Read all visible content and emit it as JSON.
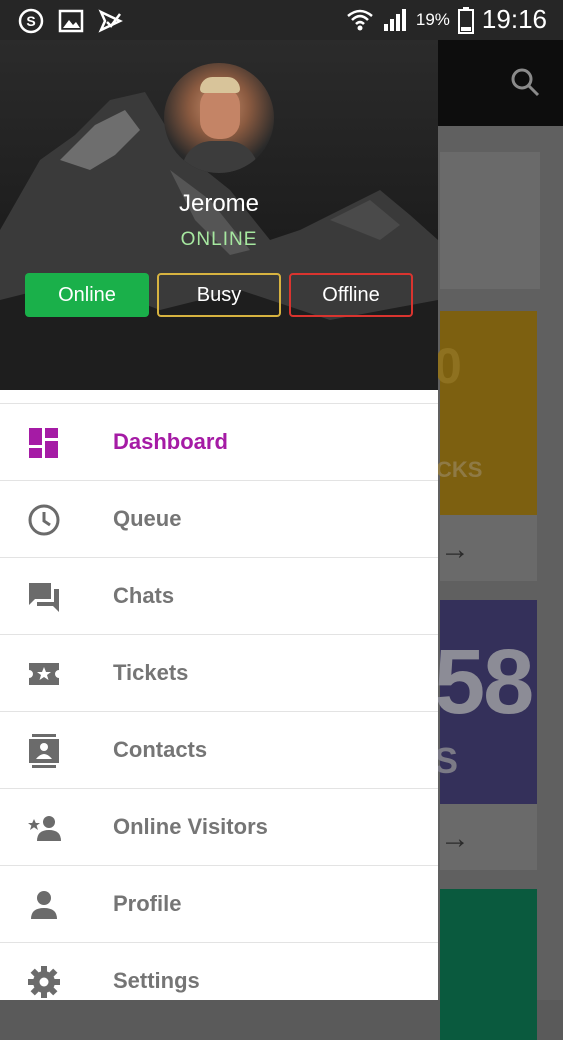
{
  "status_bar": {
    "battery_percent": "19%",
    "time": "19:16",
    "icons": [
      "skype-icon",
      "image-icon",
      "task-check-icon",
      "wifi-icon",
      "signal-icon",
      "battery-icon"
    ]
  },
  "background_app": {
    "cards": [
      {
        "color": "#7d6010",
        "text_fragment": "CKS",
        "digit_fragment": "0"
      },
      {
        "color": "#34305a",
        "number_fragment": "58",
        "text_fragment": "S"
      },
      {
        "color": "#0a5a3e"
      }
    ]
  },
  "drawer": {
    "user": {
      "name": "Jerome",
      "status": "ONLINE"
    },
    "status_buttons": [
      {
        "label": "Online",
        "color": "#1ab04a"
      },
      {
        "label": "Busy",
        "color": "#d7b340"
      },
      {
        "label": "Offline",
        "color": "#d9342f"
      }
    ],
    "menu": [
      {
        "label": "Dashboard",
        "icon": "dashboard-icon",
        "active": true
      },
      {
        "label": "Queue",
        "icon": "clock-icon"
      },
      {
        "label": "Chats",
        "icon": "chat-icon"
      },
      {
        "label": "Tickets",
        "icon": "ticket-icon"
      },
      {
        "label": "Contacts",
        "icon": "contacts-icon"
      },
      {
        "label": "Online Visitors",
        "icon": "visitors-icon"
      },
      {
        "label": "Profile",
        "icon": "person-icon"
      },
      {
        "label": "Settings",
        "icon": "gear-icon"
      }
    ],
    "accent_color": "#a51ba5"
  }
}
